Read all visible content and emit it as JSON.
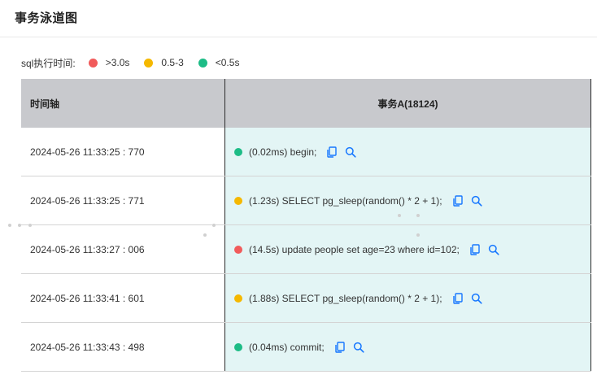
{
  "header": {
    "title": "事务泳道图"
  },
  "legend": {
    "label": "sql执行时间:",
    "items": [
      {
        "label": ">3.0s",
        "color": "#f15b5b"
      },
      {
        "label": "0.5-3",
        "color": "#f5b800"
      },
      {
        "label": "<0.5s",
        "color": "#1dbc86"
      }
    ]
  },
  "table": {
    "columns": [
      "时间轴",
      "事务A(18124)"
    ],
    "rows": [
      {
        "time": "2024-05-26 11:33:25 : 770",
        "sql": "(0.02ms) begin;",
        "status_color": "#1dbc86"
      },
      {
        "time": "2024-05-26 11:33:25 : 771",
        "sql": "(1.23s) SELECT pg_sleep(random() * 2 + 1);",
        "status_color": "#f5b800"
      },
      {
        "time": "2024-05-26 11:33:27 : 006",
        "sql": "(14.5s) update people set age=23 where id=102;",
        "status_color": "#f15b5b"
      },
      {
        "time": "2024-05-26 11:33:41 : 601",
        "sql": "(1.88s) SELECT pg_sleep(random() * 2 + 1);",
        "status_color": "#f5b800"
      },
      {
        "time": "2024-05-26 11:33:43 : 498",
        "sql": "(0.04ms) commit;",
        "status_color": "#1dbc86"
      }
    ]
  },
  "icons": {
    "copy": "copy-icon",
    "search": "search-icon",
    "accent": "#1677ff"
  }
}
